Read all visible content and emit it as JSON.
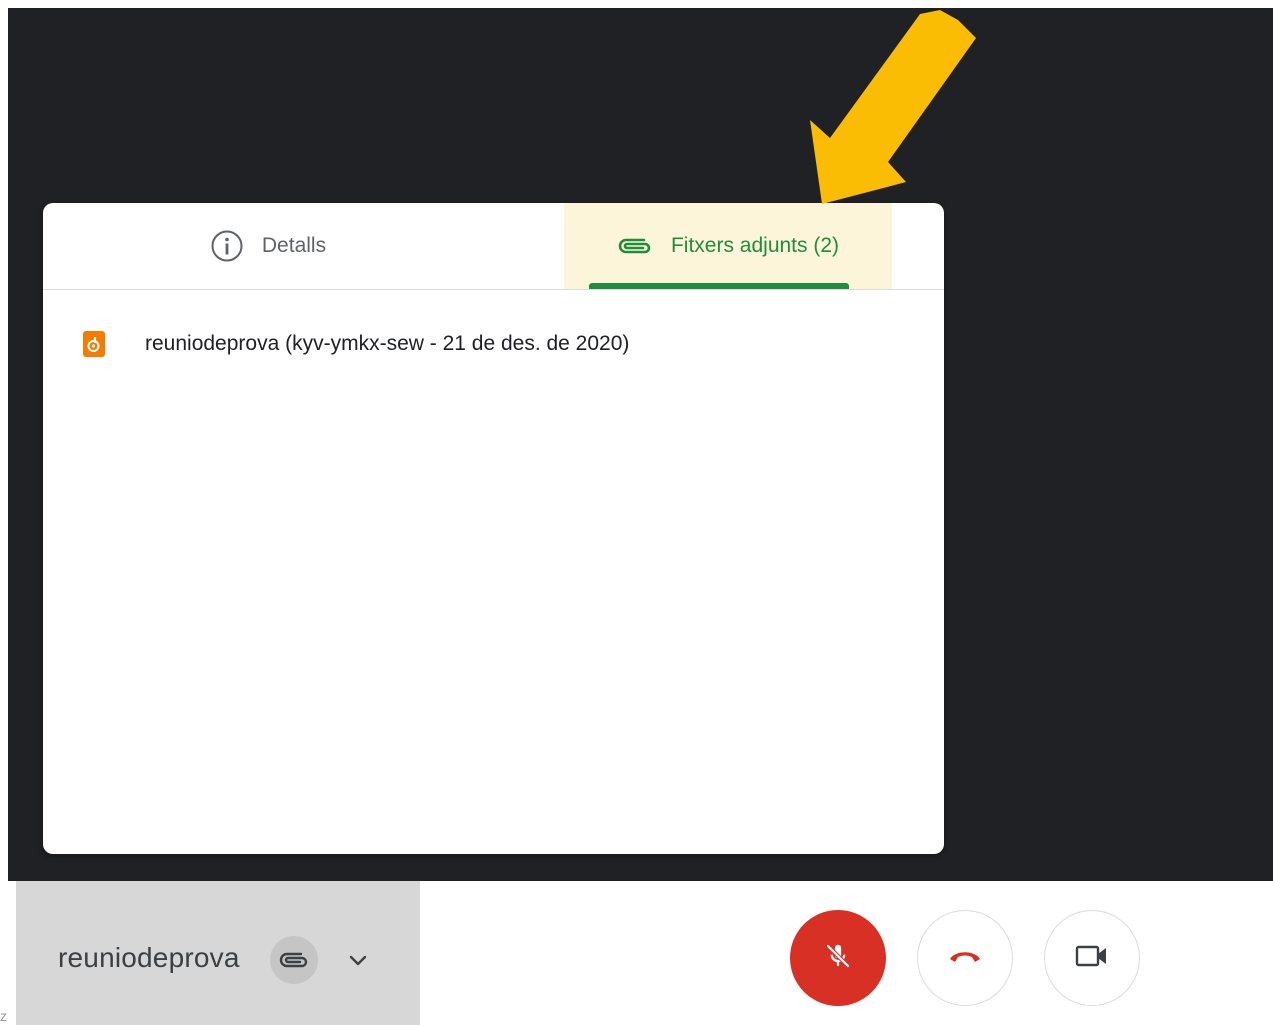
{
  "panel": {
    "tabs": [
      {
        "label": "Detalls",
        "icon": "info-icon",
        "active": false
      },
      {
        "label": "Fitxers adjunts (2)",
        "icon": "paperclip-icon",
        "active": true
      }
    ],
    "files": [
      {
        "name": "reuniodeprova (kyv-ymkx-sew - 21 de des. de 2020)",
        "icon": "meet-recording-file-icon"
      }
    ]
  },
  "meeting": {
    "name": "reuniodeprova",
    "attachment_icon": "paperclip-icon",
    "expand_icon": "chevron-down-icon"
  },
  "controls": {
    "mic": {
      "icon": "mic-off-icon",
      "state": "muted"
    },
    "hangup": {
      "icon": "phone-hangup-icon"
    },
    "camera": {
      "icon": "videocam-icon"
    }
  },
  "annotation": {
    "icon": "callout-arrow-icon",
    "color": "#fbbc04"
  },
  "colors": {
    "accent_green": "#1e8e3e",
    "active_tab_highlight": "#fdf5d9",
    "mic_muted_red": "#d93025",
    "hangup_red": "#d93025",
    "file_icon_orange": "#f57c00",
    "dark_background": "#202124"
  }
}
